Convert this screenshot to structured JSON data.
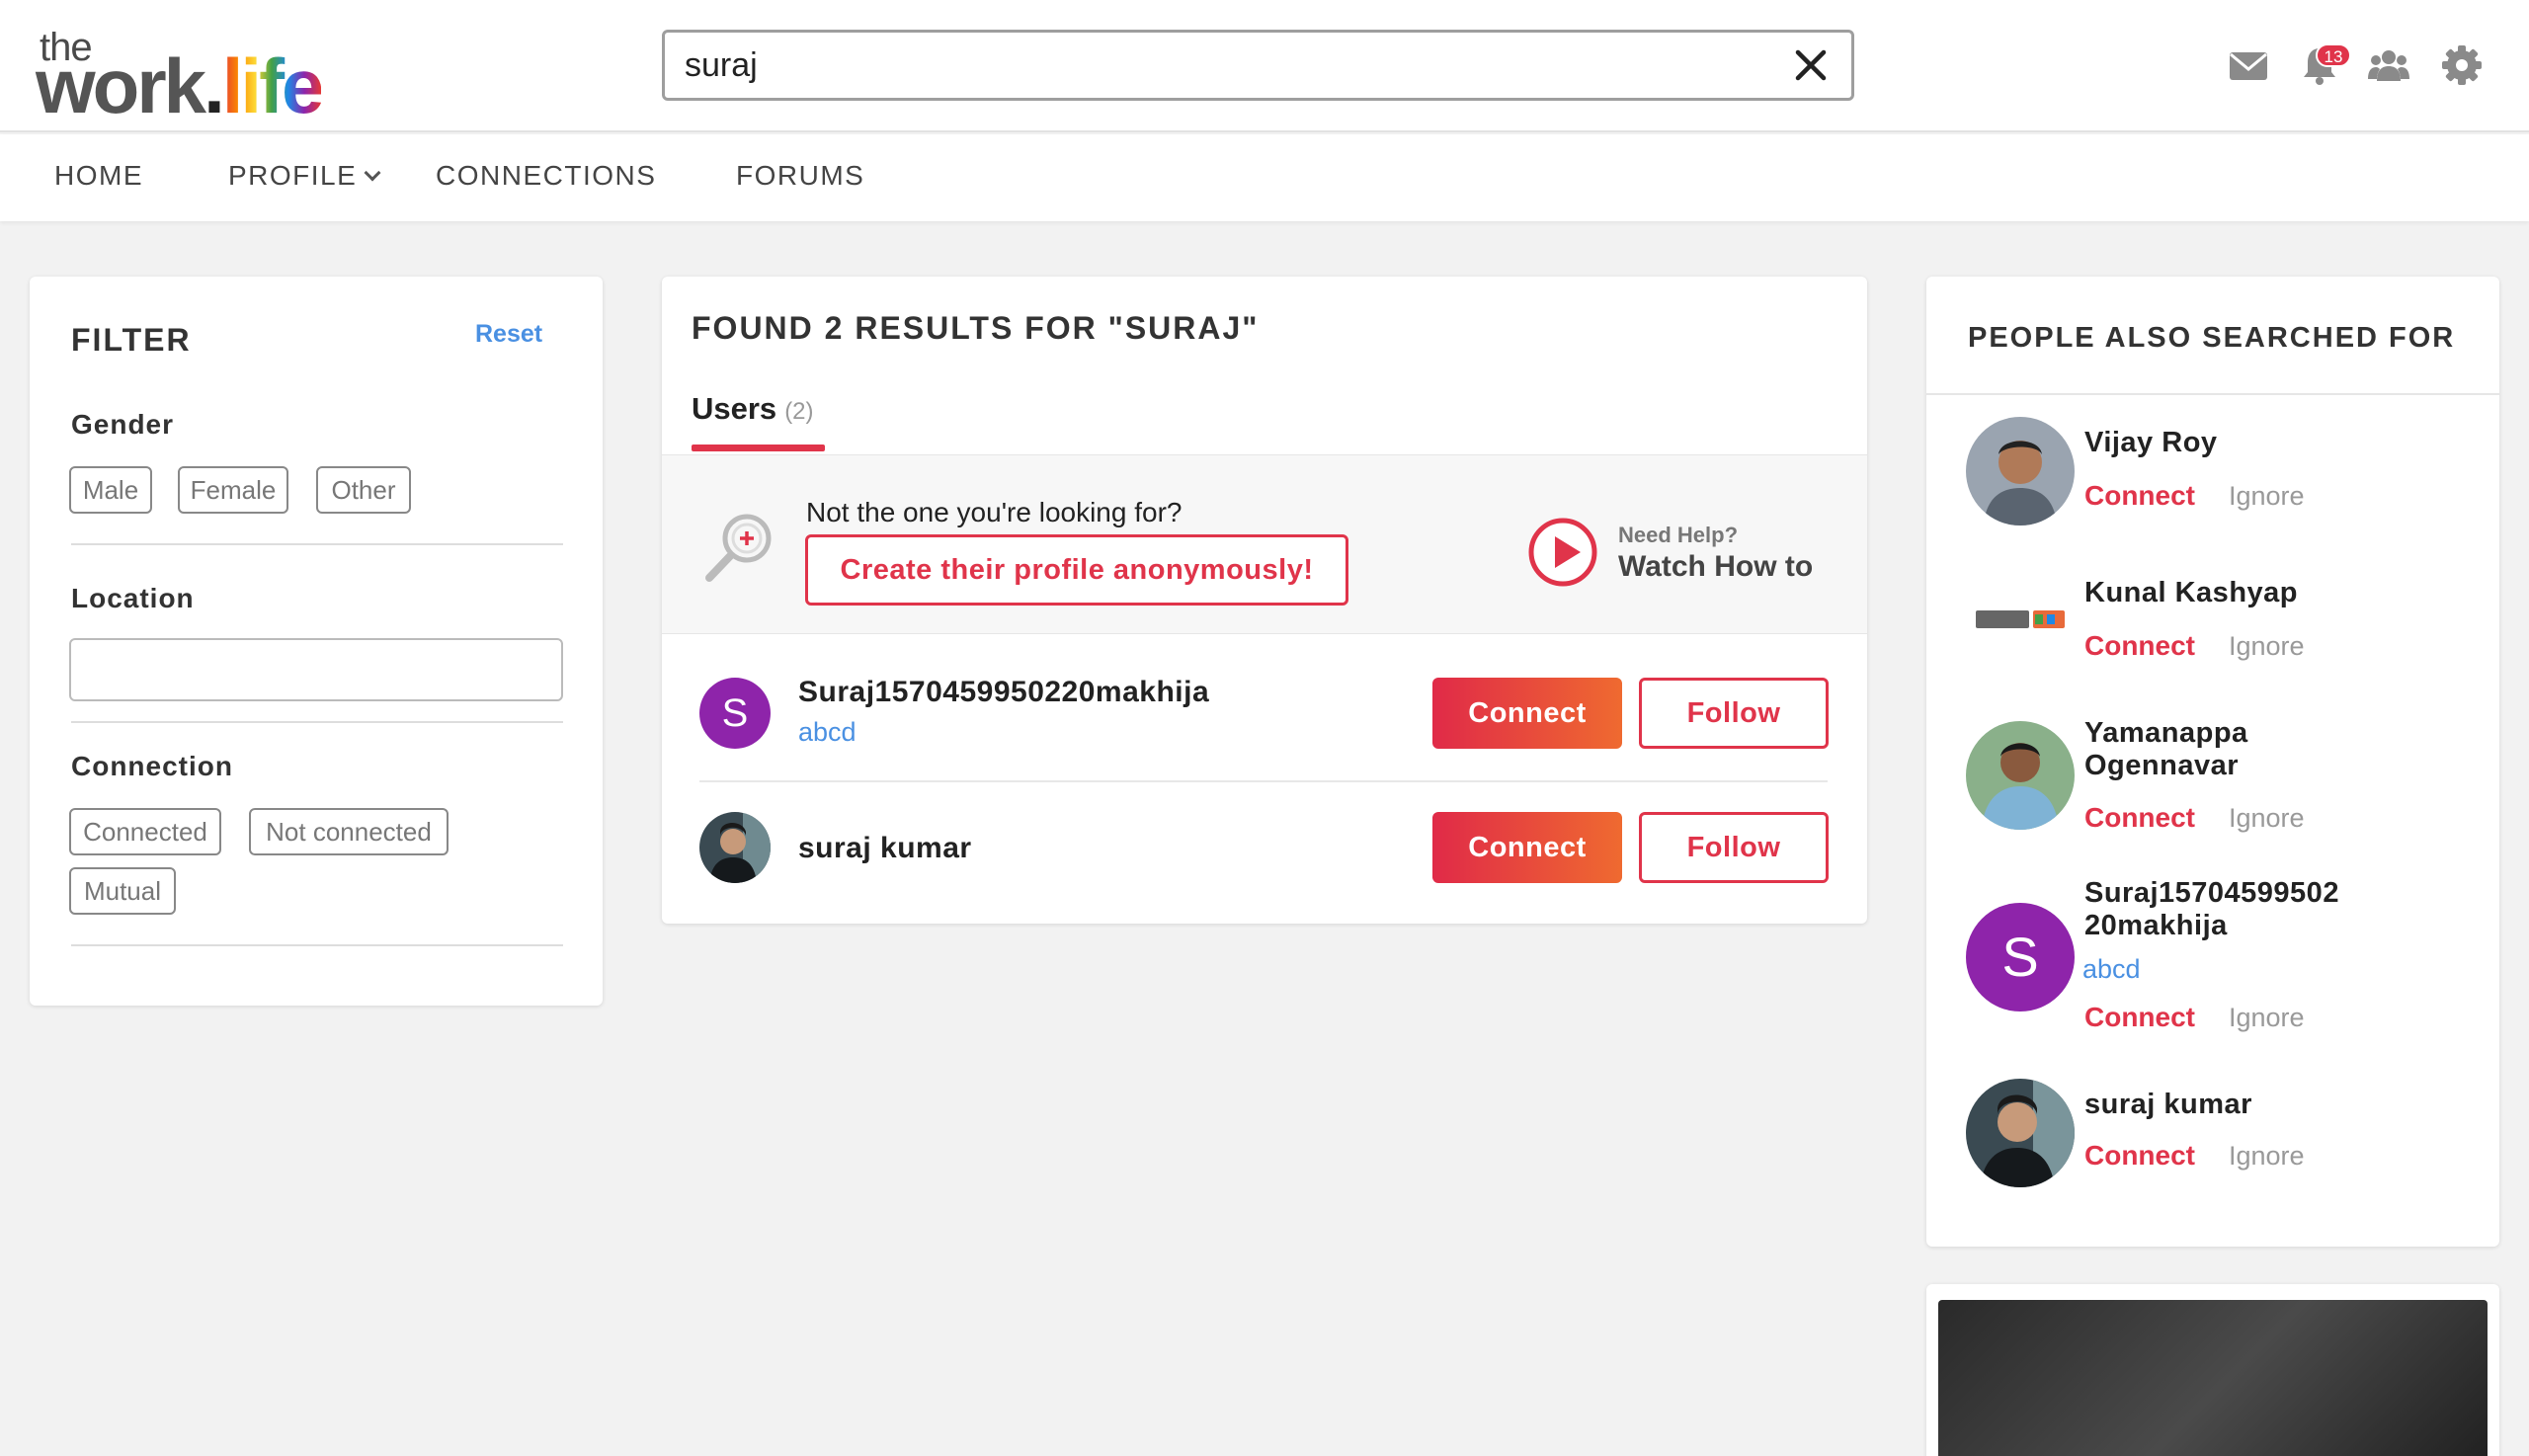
{
  "header": {
    "logo": {
      "the": "the",
      "work": "work",
      "dot": ".",
      "life": "life"
    },
    "search": {
      "value": "suraj",
      "placeholder": ""
    },
    "notifications_count": "13"
  },
  "nav": {
    "items": [
      "HOME",
      "PROFILE",
      "CONNECTIONS",
      "FORUMS"
    ]
  },
  "filter": {
    "title": "FILTER",
    "reset": "Reset",
    "gender": {
      "label": "Gender",
      "options": [
        "Male",
        "Female",
        "Other"
      ]
    },
    "location": {
      "label": "Location",
      "value": ""
    },
    "connection": {
      "label": "Connection",
      "options": [
        "Connected",
        "Not connected",
        "Mutual"
      ]
    }
  },
  "results": {
    "title": "FOUND 2 RESULTS FOR \"SURAJ\"",
    "tab_label": "Users",
    "tab_count": "(2)",
    "not_the_one": "Not the one you're looking for?",
    "create_anon": "Create their profile anonymously!",
    "need_help": "Need Help?",
    "watch_how": "Watch How to",
    "users": [
      {
        "initial": "S",
        "name": "Suraj1570459950220makhija",
        "sub": "abcd",
        "connect": "Connect",
        "follow": "Follow"
      },
      {
        "name": "suraj kumar",
        "connect": "Connect",
        "follow": "Follow"
      }
    ]
  },
  "people_also": {
    "title": "PEOPLE ALSO SEARCHED FOR",
    "connect": "Connect",
    "ignore": "Ignore",
    "people": [
      {
        "name": "Vijay Roy"
      },
      {
        "name": "Kunal Kashyap"
      },
      {
        "name_line1": "Yamanappa",
        "name_line2": "Ogennavar"
      },
      {
        "name_line1": "Suraj15704599502",
        "name_line2": "20makhija",
        "sub": "abcd",
        "initial": "S"
      },
      {
        "name": "suraj kumar"
      }
    ]
  },
  "colors": {
    "accent": "#e0344a",
    "link": "#4a90e2",
    "avatar_purple": "#8e24aa"
  },
  "icons": [
    "search-clear-icon",
    "mail-icon",
    "bell-icon",
    "people-icon",
    "gear-icon",
    "magnifier-plus-icon",
    "play-icon",
    "chevron-down-icon"
  ]
}
